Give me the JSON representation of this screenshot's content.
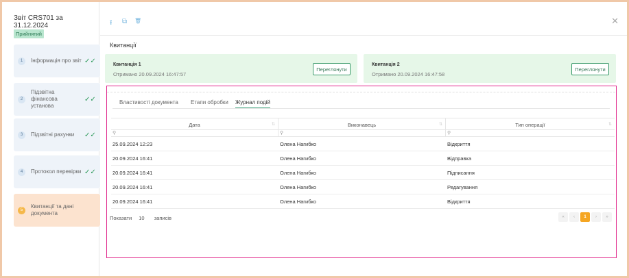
{
  "report": {
    "title": "Звіт CRS701 за 31.12.2024",
    "status": "Прийнятий"
  },
  "steps": [
    {
      "num": "1",
      "label": "Інформація про звіт",
      "checked": true
    },
    {
      "num": "2",
      "label": "Підзвітна фінансова установа",
      "checked": true
    },
    {
      "num": "3",
      "label": "Підзвітні рахунки",
      "checked": true
    },
    {
      "num": "4",
      "label": "Протокол перевірки",
      "checked": true
    },
    {
      "num": "5",
      "label": "Квитанції та дані документа",
      "checked": false
    }
  ],
  "toolbar": {
    "icons": [
      "upload-icon",
      "copy-icon",
      "delete-icon"
    ],
    "close_icon": "close-icon",
    "upload_glyph": "⭱",
    "copy_glyph": "⧉",
    "delete_glyph": "🗑",
    "close_glyph": "✕"
  },
  "receipts_title": "Квитанції",
  "receipts": [
    {
      "title": "Квитанція 1",
      "sub": "Отримано 20.09.2024 16:47:57",
      "btn": "Переглянути"
    },
    {
      "title": "Квитанція 2",
      "sub": "Отримано 20.09.2024 16:47:58",
      "btn": "Переглянути"
    }
  ],
  "tabs": [
    {
      "label": "Властивості документа",
      "active": false
    },
    {
      "label": "Етапи обробки",
      "active": false
    },
    {
      "label": "Журнал подій",
      "active": true
    }
  ],
  "table": {
    "columns": [
      "Дата",
      "Виконавець",
      "Тип операції"
    ],
    "filter_glyph": "⚲",
    "rows": [
      [
        "25.09.2024 12:23",
        "Олена Нагибко",
        "Відкриття"
      ],
      [
        "20.09.2024 16:41",
        "Олена Нагибко",
        "Відправка"
      ],
      [
        "20.09.2024 16:41",
        "Олена Нагибко",
        "Підписання"
      ],
      [
        "20.09.2024 16:41",
        "Олена Нагибко",
        "Редагування"
      ],
      [
        "20.09.2024 16:41",
        "Олена Нагибко",
        "Відкриття"
      ]
    ]
  },
  "pager": {
    "show_label": "Показати",
    "page_size": "10",
    "records_label": "записів",
    "first": "«",
    "prev": "‹",
    "current": "1",
    "next": "›",
    "last": "»"
  },
  "colors": {
    "accent_green": "#3aa078",
    "active_step": "#fce3cf",
    "highlight_border": "#e0258a",
    "page_orange": "#f5a623"
  }
}
